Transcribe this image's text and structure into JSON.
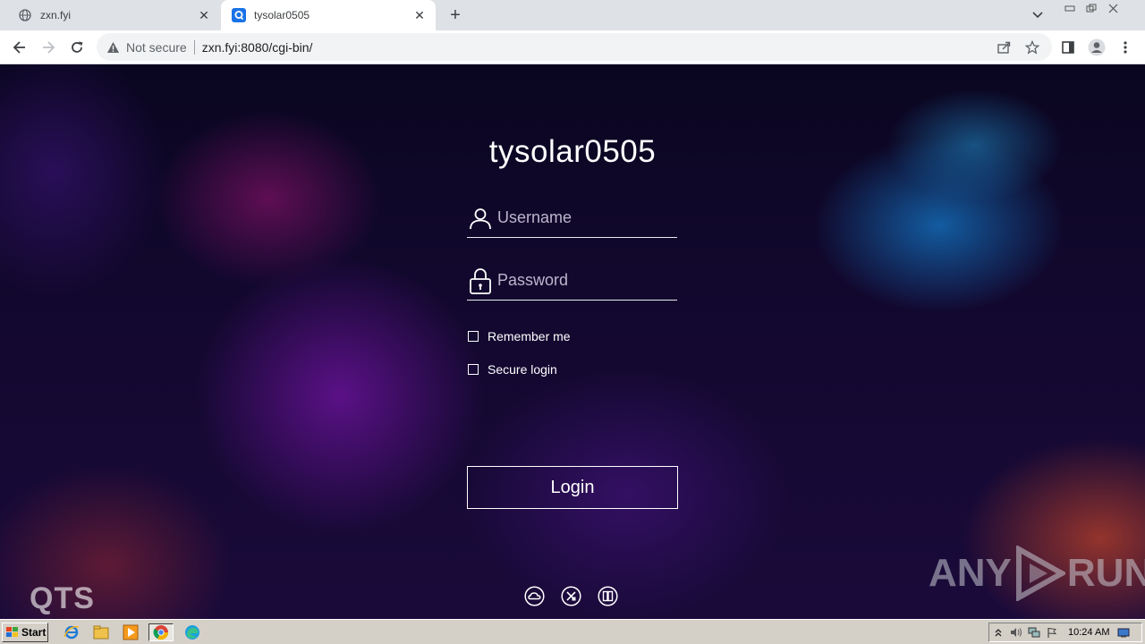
{
  "browser": {
    "tabs": [
      {
        "title": "zxn.fyi",
        "icon": "globe-icon",
        "active": false
      },
      {
        "title": "tysolar0505",
        "icon": "qnap-favicon-icon",
        "active": true
      }
    ],
    "address": {
      "security_label": "Not secure",
      "url": "zxn.fyi:8080/cgi-bin/"
    }
  },
  "login": {
    "site_title": "tysolar0505",
    "username_placeholder": "Username",
    "password_placeholder": "Password",
    "remember_label": "Remember me",
    "secure_label": "Secure login",
    "login_button": "Login"
  },
  "branding": {
    "qts_logo": "QTS",
    "watermark_left": "ANY",
    "watermark_right": "RUN"
  },
  "taskbar": {
    "start_label": "Start",
    "clock": "10:24 AM"
  },
  "colors": {
    "accent_blue": "#1a73e8",
    "chrome_bg": "#dee1e6",
    "taskbar_bg": "#d4d0c8"
  }
}
